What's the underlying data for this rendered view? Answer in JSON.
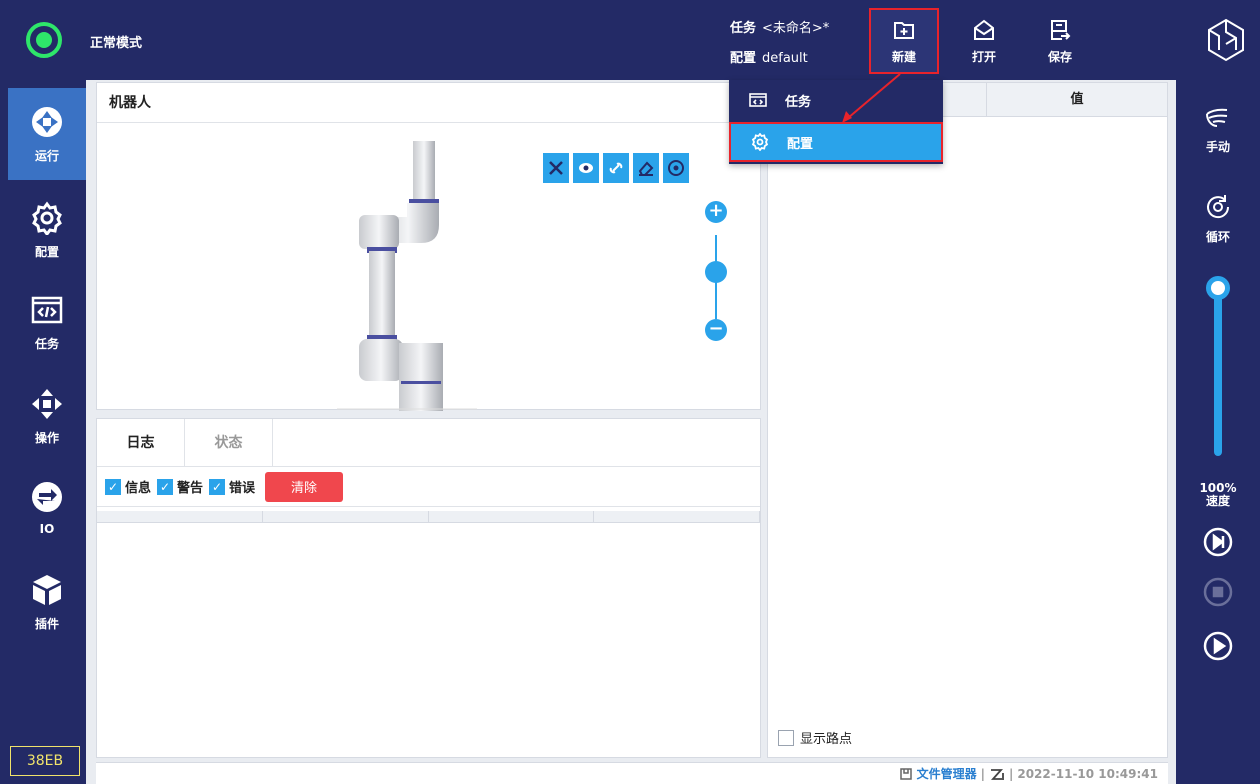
{
  "header": {
    "mode": "正常模式",
    "task_label": "任务",
    "task_value": "<未命名>*",
    "config_label": "配置",
    "config_value": "default",
    "new_label": "新建",
    "open_label": "打开",
    "save_label": "保存"
  },
  "sidebar": {
    "items": [
      {
        "label": "运行",
        "icon": "run-icon"
      },
      {
        "label": "配置",
        "icon": "gear-icon"
      },
      {
        "label": "任务",
        "icon": "code-window-icon"
      },
      {
        "label": "操作",
        "icon": "move-arrows-icon"
      },
      {
        "label": "IO",
        "icon": "swap-icon"
      },
      {
        "label": "插件",
        "icon": "cube-icon"
      }
    ],
    "device_id": "38EB"
  },
  "right_bar": {
    "manual_label": "手动",
    "loop_label": "循环",
    "speed_value": "100%",
    "speed_label": "速度"
  },
  "robot_panel": {
    "title": "机器人"
  },
  "log_panel": {
    "tabs": [
      "日志",
      "状态"
    ],
    "filters": [
      "信息",
      "警告",
      "错误"
    ],
    "clear_label": "清除"
  },
  "vars_panel": {
    "value_header": "值",
    "show_waypoints": "显示路点"
  },
  "new_menu": {
    "items": [
      {
        "label": "任务",
        "icon": "code-window-icon"
      },
      {
        "label": "配置",
        "icon": "gear-icon"
      }
    ]
  },
  "footer": {
    "file_manager": "文件管理器",
    "datetime": "2022-11-10 10:49:41"
  },
  "colors": {
    "navy": "#232a66",
    "accent": "#2aa3ea",
    "highlight": "#e8232b",
    "status_green": "#2ee66a"
  }
}
